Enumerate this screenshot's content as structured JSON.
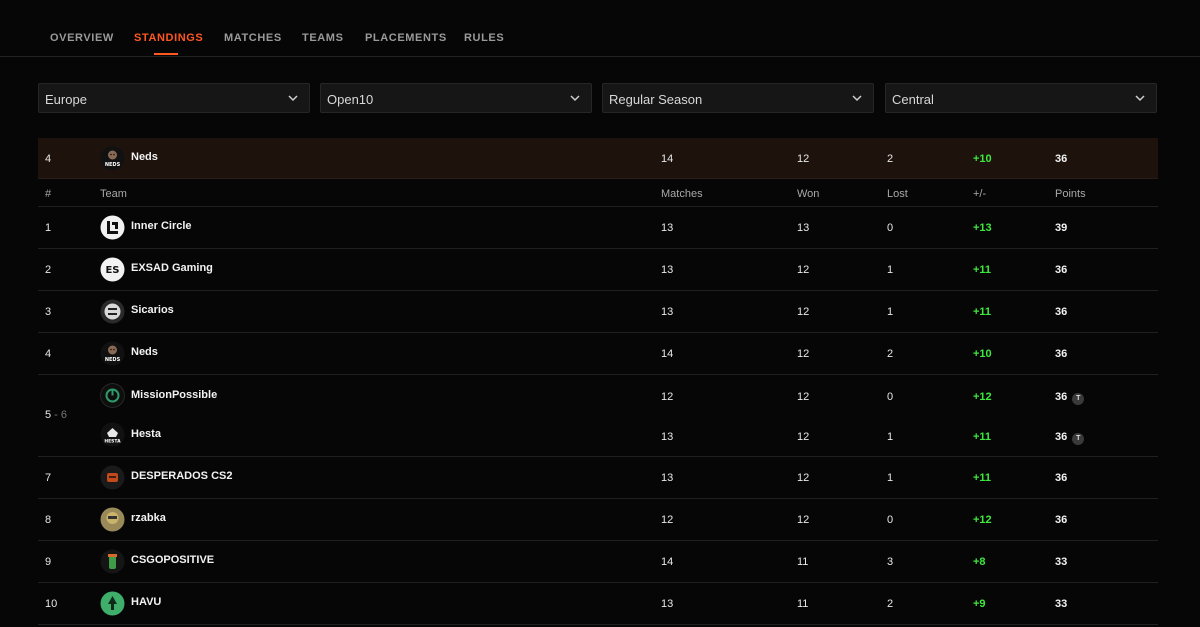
{
  "nav": {
    "tabs": [
      {
        "label": "OVERVIEW",
        "active": false
      },
      {
        "label": "STANDINGS",
        "active": true
      },
      {
        "label": "MATCHES",
        "active": false
      },
      {
        "label": "TEAMS",
        "active": false
      },
      {
        "label": "PLACEMENTS",
        "active": false
      },
      {
        "label": "RULES",
        "active": false
      }
    ],
    "accent": "#ff5722"
  },
  "filters": [
    {
      "value": "Europe"
    },
    {
      "value": "Open10"
    },
    {
      "value": "Regular Season"
    },
    {
      "value": "Central"
    }
  ],
  "highlight_row": {
    "rank": "4",
    "team": "Neds",
    "logo": "neds-logo-icon",
    "matches": "14",
    "won": "12",
    "lost": "2",
    "diff": "+10",
    "points": "36"
  },
  "columns": {
    "rank": "#",
    "team": "Team",
    "matches": "Matches",
    "won": "Won",
    "lost": "Lost",
    "diff": "+/-",
    "points": "Points"
  },
  "rows": [
    {
      "rank": "1",
      "team": "Inner Circle",
      "logo": "inner-circle-logo-icon",
      "matches": "13",
      "won": "13",
      "lost": "0",
      "diff": "+13",
      "points": "39"
    },
    {
      "rank": "2",
      "team": "EXSAD Gaming",
      "logo": "exsad-logo-icon",
      "matches": "13",
      "won": "12",
      "lost": "1",
      "diff": "+11",
      "points": "36"
    },
    {
      "rank": "3",
      "team": "Sicarios",
      "logo": "sicarios-logo-icon",
      "matches": "13",
      "won": "12",
      "lost": "1",
      "diff": "+11",
      "points": "36"
    },
    {
      "rank": "4",
      "team": "Neds",
      "logo": "neds-logo-icon",
      "matches": "14",
      "won": "12",
      "lost": "2",
      "diff": "+10",
      "points": "36"
    }
  ],
  "tie_group": {
    "rank_start": "5",
    "rank_sep": " - ",
    "rank_end": "6",
    "tie_badge": "T",
    "teams": [
      {
        "team": "MissionPossible",
        "logo": "missionpossible-logo-icon",
        "matches": "12",
        "won": "12",
        "lost": "0",
        "diff": "+12",
        "points": "36"
      },
      {
        "team": "Hesta",
        "logo": "hesta-logo-icon",
        "matches": "13",
        "won": "12",
        "lost": "1",
        "diff": "+11",
        "points": "36"
      }
    ]
  },
  "rows_after": [
    {
      "rank": "7",
      "team": "DESPERADOS CS2",
      "logo": "desperados-logo-icon",
      "matches": "13",
      "won": "12",
      "lost": "1",
      "diff": "+11",
      "points": "36"
    },
    {
      "rank": "8",
      "team": "rzabka",
      "logo": "rzabka-logo-icon",
      "matches": "12",
      "won": "12",
      "lost": "0",
      "diff": "+12",
      "points": "36"
    },
    {
      "rank": "9",
      "team": "CSGOPOSITIVE",
      "logo": "csgopositive-logo-icon",
      "matches": "14",
      "won": "11",
      "lost": "3",
      "diff": "+8",
      "points": "33"
    },
    {
      "rank": "10",
      "team": "HAVU",
      "logo": "havu-logo-icon",
      "matches": "13",
      "won": "11",
      "lost": "2",
      "diff": "+9",
      "points": "33"
    }
  ]
}
